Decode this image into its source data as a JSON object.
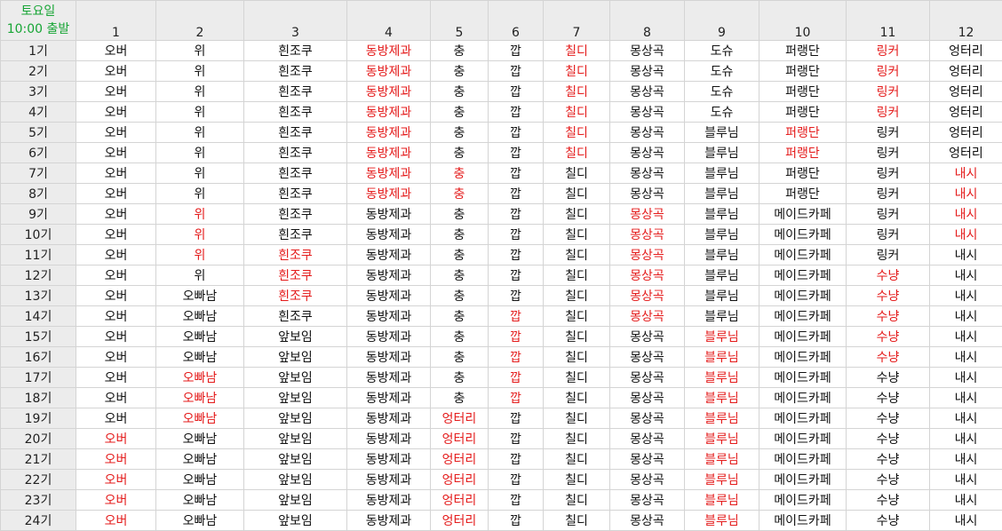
{
  "corner": {
    "day": "토요일",
    "departure": "10:00 출발"
  },
  "columns": [
    "1",
    "2",
    "3",
    "4",
    "5",
    "6",
    "7",
    "8",
    "9",
    "10",
    "11",
    "12"
  ],
  "colors": {
    "highlight": "#e41b1b",
    "corner_text": "#17a535",
    "header_bg": "#ececec",
    "grid": "#d4d4d4"
  },
  "rows": [
    {
      "label": "1기",
      "cells": [
        {
          "v": "오버"
        },
        {
          "v": "위"
        },
        {
          "v": "흰조쿠"
        },
        {
          "v": "동방제과",
          "hl": true
        },
        {
          "v": "충"
        },
        {
          "v": "깝"
        },
        {
          "v": "칠디",
          "hl": true
        },
        {
          "v": "몽상곡"
        },
        {
          "v": "도슈"
        },
        {
          "v": "퍼랭단"
        },
        {
          "v": "링커",
          "hl": true
        },
        {
          "v": "엉터리"
        }
      ]
    },
    {
      "label": "2기",
      "cells": [
        {
          "v": "오버"
        },
        {
          "v": "위"
        },
        {
          "v": "흰조쿠"
        },
        {
          "v": "동방제과",
          "hl": true
        },
        {
          "v": "충"
        },
        {
          "v": "깝"
        },
        {
          "v": "칠디",
          "hl": true
        },
        {
          "v": "몽상곡"
        },
        {
          "v": "도슈"
        },
        {
          "v": "퍼랭단"
        },
        {
          "v": "링커",
          "hl": true
        },
        {
          "v": "엉터리"
        }
      ]
    },
    {
      "label": "3기",
      "cells": [
        {
          "v": "오버"
        },
        {
          "v": "위"
        },
        {
          "v": "흰조쿠"
        },
        {
          "v": "동방제과",
          "hl": true
        },
        {
          "v": "충"
        },
        {
          "v": "깝"
        },
        {
          "v": "칠디",
          "hl": true
        },
        {
          "v": "몽상곡"
        },
        {
          "v": "도슈"
        },
        {
          "v": "퍼랭단"
        },
        {
          "v": "링커",
          "hl": true
        },
        {
          "v": "엉터리"
        }
      ]
    },
    {
      "label": "4기",
      "cells": [
        {
          "v": "오버"
        },
        {
          "v": "위"
        },
        {
          "v": "흰조쿠"
        },
        {
          "v": "동방제과",
          "hl": true
        },
        {
          "v": "충"
        },
        {
          "v": "깝"
        },
        {
          "v": "칠디",
          "hl": true
        },
        {
          "v": "몽상곡"
        },
        {
          "v": "도슈"
        },
        {
          "v": "퍼랭단"
        },
        {
          "v": "링커",
          "hl": true
        },
        {
          "v": "엉터리"
        }
      ]
    },
    {
      "label": "5기",
      "cells": [
        {
          "v": "오버"
        },
        {
          "v": "위"
        },
        {
          "v": "흰조쿠"
        },
        {
          "v": "동방제과",
          "hl": true
        },
        {
          "v": "충"
        },
        {
          "v": "깝"
        },
        {
          "v": "칠디",
          "hl": true
        },
        {
          "v": "몽상곡"
        },
        {
          "v": "블루님"
        },
        {
          "v": "퍼랭단",
          "hl": true
        },
        {
          "v": "링커"
        },
        {
          "v": "엉터리"
        }
      ]
    },
    {
      "label": "6기",
      "cells": [
        {
          "v": "오버"
        },
        {
          "v": "위"
        },
        {
          "v": "흰조쿠"
        },
        {
          "v": "동방제과",
          "hl": true
        },
        {
          "v": "충"
        },
        {
          "v": "깝"
        },
        {
          "v": "칠디",
          "hl": true
        },
        {
          "v": "몽상곡"
        },
        {
          "v": "블루님"
        },
        {
          "v": "퍼랭단",
          "hl": true
        },
        {
          "v": "링커"
        },
        {
          "v": "엉터리"
        }
      ]
    },
    {
      "label": "7기",
      "cells": [
        {
          "v": "오버"
        },
        {
          "v": "위"
        },
        {
          "v": "흰조쿠"
        },
        {
          "v": "동방제과",
          "hl": true
        },
        {
          "v": "충",
          "hl": true
        },
        {
          "v": "깝"
        },
        {
          "v": "칠디"
        },
        {
          "v": "몽상곡"
        },
        {
          "v": "블루님"
        },
        {
          "v": "퍼랭단"
        },
        {
          "v": "링커"
        },
        {
          "v": "내시",
          "hl": true
        }
      ]
    },
    {
      "label": "8기",
      "cells": [
        {
          "v": "오버"
        },
        {
          "v": "위"
        },
        {
          "v": "흰조쿠"
        },
        {
          "v": "동방제과",
          "hl": true
        },
        {
          "v": "충",
          "hl": true
        },
        {
          "v": "깝"
        },
        {
          "v": "칠디"
        },
        {
          "v": "몽상곡"
        },
        {
          "v": "블루님"
        },
        {
          "v": "퍼랭단"
        },
        {
          "v": "링커"
        },
        {
          "v": "내시",
          "hl": true
        }
      ]
    },
    {
      "label": "9기",
      "cells": [
        {
          "v": "오버"
        },
        {
          "v": "위",
          "hl": true
        },
        {
          "v": "흰조쿠"
        },
        {
          "v": "동방제과"
        },
        {
          "v": "충"
        },
        {
          "v": "깝"
        },
        {
          "v": "칠디"
        },
        {
          "v": "몽상곡",
          "hl": true
        },
        {
          "v": "블루님"
        },
        {
          "v": "메이드카페"
        },
        {
          "v": "링커"
        },
        {
          "v": "내시",
          "hl": true
        }
      ]
    },
    {
      "label": "10기",
      "cells": [
        {
          "v": "오버"
        },
        {
          "v": "위",
          "hl": true
        },
        {
          "v": "흰조쿠"
        },
        {
          "v": "동방제과"
        },
        {
          "v": "충"
        },
        {
          "v": "깝"
        },
        {
          "v": "칠디"
        },
        {
          "v": "몽상곡",
          "hl": true
        },
        {
          "v": "블루님"
        },
        {
          "v": "메이드카페"
        },
        {
          "v": "링커"
        },
        {
          "v": "내시",
          "hl": true
        }
      ]
    },
    {
      "label": "11기",
      "cells": [
        {
          "v": "오버"
        },
        {
          "v": "위",
          "hl": true
        },
        {
          "v": "흰조쿠",
          "hl": true
        },
        {
          "v": "동방제과"
        },
        {
          "v": "충"
        },
        {
          "v": "깝"
        },
        {
          "v": "칠디"
        },
        {
          "v": "몽상곡",
          "hl": true
        },
        {
          "v": "블루님"
        },
        {
          "v": "메이드카페"
        },
        {
          "v": "링커"
        },
        {
          "v": "내시"
        }
      ]
    },
    {
      "label": "12기",
      "cells": [
        {
          "v": "오버"
        },
        {
          "v": "위"
        },
        {
          "v": "흰조쿠",
          "hl": true
        },
        {
          "v": "동방제과"
        },
        {
          "v": "충"
        },
        {
          "v": "깝"
        },
        {
          "v": "칠디"
        },
        {
          "v": "몽상곡",
          "hl": true
        },
        {
          "v": "블루님"
        },
        {
          "v": "메이드카페"
        },
        {
          "v": "수냥",
          "hl": true
        },
        {
          "v": "내시"
        }
      ]
    },
    {
      "label": "13기",
      "cells": [
        {
          "v": "오버"
        },
        {
          "v": "오빠남"
        },
        {
          "v": "흰조쿠",
          "hl": true
        },
        {
          "v": "동방제과"
        },
        {
          "v": "충"
        },
        {
          "v": "깝"
        },
        {
          "v": "칠디"
        },
        {
          "v": "몽상곡",
          "hl": true
        },
        {
          "v": "블루님"
        },
        {
          "v": "메이드카페"
        },
        {
          "v": "수냥",
          "hl": true
        },
        {
          "v": "내시"
        }
      ]
    },
    {
      "label": "14기",
      "cells": [
        {
          "v": "오버"
        },
        {
          "v": "오빠남"
        },
        {
          "v": "흰조쿠"
        },
        {
          "v": "동방제과"
        },
        {
          "v": "충"
        },
        {
          "v": "깝",
          "hl": true
        },
        {
          "v": "칠디"
        },
        {
          "v": "몽상곡",
          "hl": true
        },
        {
          "v": "블루님"
        },
        {
          "v": "메이드카페"
        },
        {
          "v": "수냥",
          "hl": true
        },
        {
          "v": "내시"
        }
      ]
    },
    {
      "label": "15기",
      "cells": [
        {
          "v": "오버"
        },
        {
          "v": "오빠남"
        },
        {
          "v": "앞보임"
        },
        {
          "v": "동방제과"
        },
        {
          "v": "충"
        },
        {
          "v": "깝",
          "hl": true
        },
        {
          "v": "칠디"
        },
        {
          "v": "몽상곡"
        },
        {
          "v": "블루님",
          "hl": true
        },
        {
          "v": "메이드카페"
        },
        {
          "v": "수냥",
          "hl": true
        },
        {
          "v": "내시"
        }
      ]
    },
    {
      "label": "16기",
      "cells": [
        {
          "v": "오버"
        },
        {
          "v": "오빠남"
        },
        {
          "v": "앞보임"
        },
        {
          "v": "동방제과"
        },
        {
          "v": "충"
        },
        {
          "v": "깝",
          "hl": true
        },
        {
          "v": "칠디"
        },
        {
          "v": "몽상곡"
        },
        {
          "v": "블루님",
          "hl": true
        },
        {
          "v": "메이드카페"
        },
        {
          "v": "수냥",
          "hl": true
        },
        {
          "v": "내시"
        }
      ]
    },
    {
      "label": "17기",
      "cells": [
        {
          "v": "오버"
        },
        {
          "v": "오빠남",
          "hl": true
        },
        {
          "v": "앞보임"
        },
        {
          "v": "동방제과"
        },
        {
          "v": "충"
        },
        {
          "v": "깝",
          "hl": true
        },
        {
          "v": "칠디"
        },
        {
          "v": "몽상곡"
        },
        {
          "v": "블루님",
          "hl": true
        },
        {
          "v": "메이드카페"
        },
        {
          "v": "수냥"
        },
        {
          "v": "내시"
        }
      ]
    },
    {
      "label": "18기",
      "cells": [
        {
          "v": "오버"
        },
        {
          "v": "오빠남",
          "hl": true
        },
        {
          "v": "앞보임"
        },
        {
          "v": "동방제과"
        },
        {
          "v": "충"
        },
        {
          "v": "깝",
          "hl": true
        },
        {
          "v": "칠디"
        },
        {
          "v": "몽상곡"
        },
        {
          "v": "블루님",
          "hl": true
        },
        {
          "v": "메이드카페"
        },
        {
          "v": "수냥"
        },
        {
          "v": "내시"
        }
      ]
    },
    {
      "label": "19기",
      "cells": [
        {
          "v": "오버"
        },
        {
          "v": "오빠남",
          "hl": true
        },
        {
          "v": "앞보임"
        },
        {
          "v": "동방제과"
        },
        {
          "v": "엉터리",
          "hl": true
        },
        {
          "v": "깝"
        },
        {
          "v": "칠디"
        },
        {
          "v": "몽상곡"
        },
        {
          "v": "블루님",
          "hl": true
        },
        {
          "v": "메이드카페"
        },
        {
          "v": "수냥"
        },
        {
          "v": "내시"
        }
      ]
    },
    {
      "label": "20기",
      "cells": [
        {
          "v": "오버",
          "hl": true
        },
        {
          "v": "오빠남"
        },
        {
          "v": "앞보임"
        },
        {
          "v": "동방제과"
        },
        {
          "v": "엉터리",
          "hl": true
        },
        {
          "v": "깝"
        },
        {
          "v": "칠디"
        },
        {
          "v": "몽상곡"
        },
        {
          "v": "블루님",
          "hl": true
        },
        {
          "v": "메이드카페"
        },
        {
          "v": "수냥"
        },
        {
          "v": "내시"
        }
      ]
    },
    {
      "label": "21기",
      "cells": [
        {
          "v": "오버",
          "hl": true
        },
        {
          "v": "오빠남"
        },
        {
          "v": "앞보임"
        },
        {
          "v": "동방제과"
        },
        {
          "v": "엉터리",
          "hl": true
        },
        {
          "v": "깝"
        },
        {
          "v": "칠디"
        },
        {
          "v": "몽상곡"
        },
        {
          "v": "블루님",
          "hl": true
        },
        {
          "v": "메이드카페"
        },
        {
          "v": "수냥"
        },
        {
          "v": "내시"
        }
      ]
    },
    {
      "label": "22기",
      "cells": [
        {
          "v": "오버",
          "hl": true
        },
        {
          "v": "오빠남"
        },
        {
          "v": "앞보임"
        },
        {
          "v": "동방제과"
        },
        {
          "v": "엉터리",
          "hl": true
        },
        {
          "v": "깝"
        },
        {
          "v": "칠디"
        },
        {
          "v": "몽상곡"
        },
        {
          "v": "블루님",
          "hl": true
        },
        {
          "v": "메이드카페"
        },
        {
          "v": "수냥"
        },
        {
          "v": "내시"
        }
      ]
    },
    {
      "label": "23기",
      "cells": [
        {
          "v": "오버",
          "hl": true
        },
        {
          "v": "오빠남"
        },
        {
          "v": "앞보임"
        },
        {
          "v": "동방제과"
        },
        {
          "v": "엉터리",
          "hl": true
        },
        {
          "v": "깝"
        },
        {
          "v": "칠디"
        },
        {
          "v": "몽상곡"
        },
        {
          "v": "블루님",
          "hl": true
        },
        {
          "v": "메이드카페"
        },
        {
          "v": "수냥"
        },
        {
          "v": "내시"
        }
      ]
    },
    {
      "label": "24기",
      "cells": [
        {
          "v": "오버",
          "hl": true
        },
        {
          "v": "오빠남"
        },
        {
          "v": "앞보임"
        },
        {
          "v": "동방제과"
        },
        {
          "v": "엉터리",
          "hl": true
        },
        {
          "v": "깝"
        },
        {
          "v": "칠디"
        },
        {
          "v": "몽상곡"
        },
        {
          "v": "블루님",
          "hl": true
        },
        {
          "v": "메이드카페"
        },
        {
          "v": "수냥"
        },
        {
          "v": "내시"
        }
      ]
    }
  ]
}
